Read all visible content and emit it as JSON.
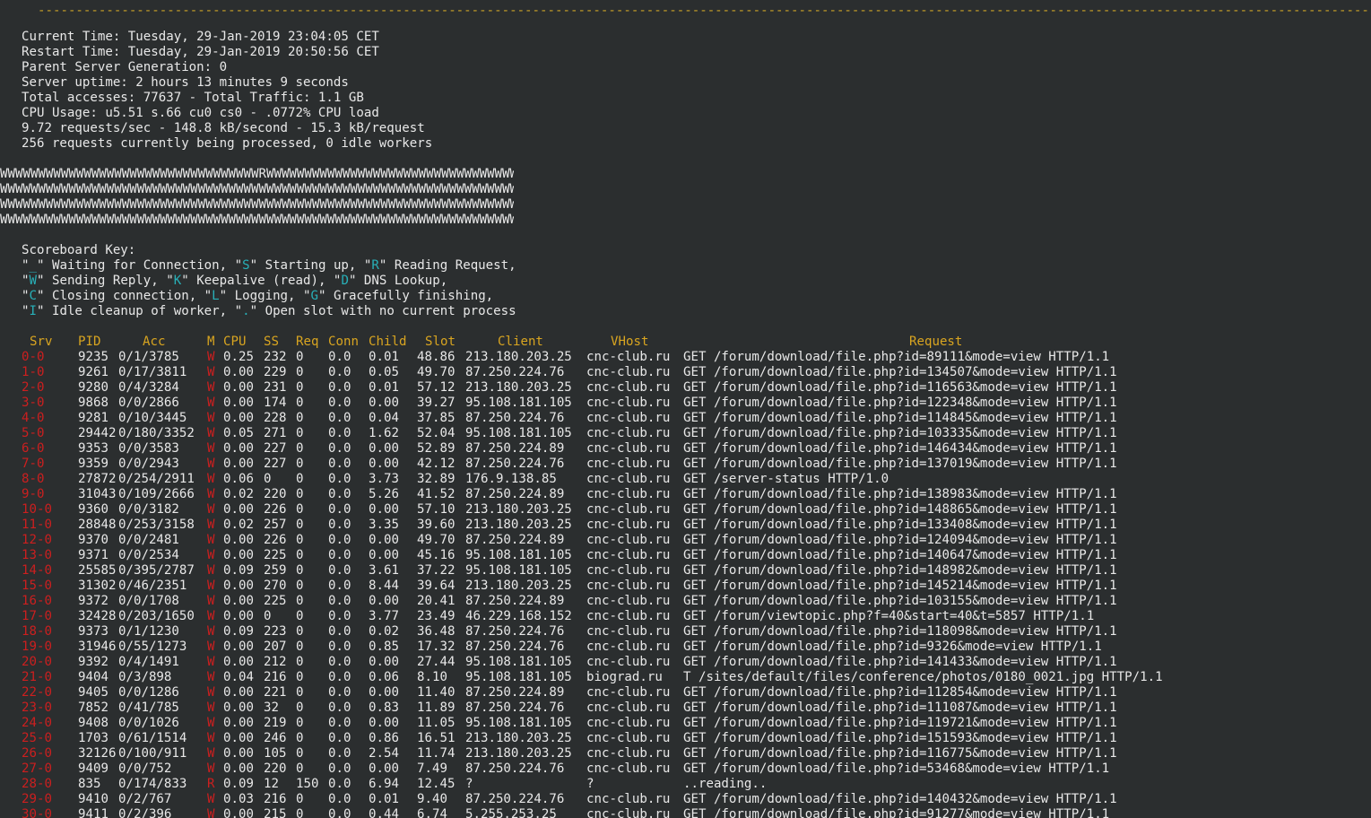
{
  "dashes": "----------------------------------------------------------------------------------------------------------------------------------------------------------------------------------------------------------------------------",
  "info": [
    "Current Time: Tuesday, 29-Jan-2019 23:04:05 CET",
    "Restart Time: Tuesday, 29-Jan-2019 20:50:56 CET",
    "Parent Server Generation: 0",
    "Server uptime: 2 hours 13 minutes 9 seconds",
    "Total accesses: 77637 - Total Traffic: 1.1 GB",
    "CPU Usage: u5.51 s.66 cu0 cs0 - .0772% CPU load",
    "9.72 requests/sec - 148.8 kB/second - 15.3 kB/request",
    "256 requests currently being processed, 0 idle workers"
  ],
  "scoreboard": [
    "WWWWWWWWWWWWWWWWWWWWWWWWWWWWWWWWWWRWWWWWWWWWWWWWWWWWWWWWWWWWWWWWWWWWWWW",
    "WWWWWWWWWWWWWWWWWWWWWWWWWWWWWWWWWWWWWWWWWWWWWWWWWWWWWWWWWWWWWWWWWWWWWWWW",
    "WWWWWWWWWWWWWWWWWWWWWWWWWWWWWWWWWWWWWWWWWWWWWWWWWWWWWWWWWWWWWWWWWWWWWWWW",
    "WWWWWWWWWWWWWWWWWWWWWWWWWWWWWWWWWWWWWWWWWWWWWWWWWWWWWWWWWWWWWWWWWWWWWWWW"
  ],
  "key": {
    "title": "Scoreboard Key:",
    "lines": [
      [
        [
          "\"",
          "q"
        ],
        [
          "_",
          "kc"
        ],
        [
          "\" Waiting for Connection, \"",
          "q"
        ],
        [
          "S",
          "kc"
        ],
        [
          "\" Starting up, \"",
          "q"
        ],
        [
          "R",
          "kc"
        ],
        [
          "\" Reading Request,",
          "q"
        ]
      ],
      [
        [
          "\"",
          "q"
        ],
        [
          "W",
          "kc"
        ],
        [
          "\" Sending Reply, \"",
          "q"
        ],
        [
          "K",
          "kc"
        ],
        [
          "\" Keepalive (read), \"",
          "q"
        ],
        [
          "D",
          "kc"
        ],
        [
          "\" DNS Lookup,",
          "q"
        ]
      ],
      [
        [
          "\"",
          "q"
        ],
        [
          "C",
          "kc"
        ],
        [
          "\" Closing connection, \"",
          "q"
        ],
        [
          "L",
          "kc"
        ],
        [
          "\" Logging, \"",
          "q"
        ],
        [
          "G",
          "kc"
        ],
        [
          "\" Gracefully finishing,",
          "q"
        ]
      ],
      [
        [
          "\"",
          "q"
        ],
        [
          "I",
          "kc"
        ],
        [
          "\" Idle cleanup of worker, \"",
          "q"
        ],
        [
          ".",
          "kc"
        ],
        [
          "\" Open slot with no current process",
          "q"
        ]
      ]
    ]
  },
  "table": {
    "headers": [
      "Srv",
      "PID",
      "Acc",
      "M",
      "CPU",
      "SS",
      "Req",
      "Conn",
      "Child",
      "Slot",
      "Client",
      "VHost",
      "Request"
    ],
    "rows": [
      [
        "0-0",
        "9235",
        "0/1/3785",
        "W",
        "0.25",
        "232",
        "0",
        "0.0",
        "0.01",
        "48.86",
        "213.180.203.25",
        "cnc-club.ru",
        "GET /forum/download/file.php?id=89111&mode=view HTTP/1.1"
      ],
      [
        "1-0",
        "9261",
        "0/17/3811",
        "W",
        "0.00",
        "229",
        "0",
        "0.0",
        "0.05",
        "49.70",
        "87.250.224.76",
        "cnc-club.ru",
        "GET /forum/download/file.php?id=134507&mode=view HTTP/1.1"
      ],
      [
        "2-0",
        "9280",
        "0/4/3284",
        "W",
        "0.00",
        "231",
        "0",
        "0.0",
        "0.01",
        "57.12",
        "213.180.203.25",
        "cnc-club.ru",
        "GET /forum/download/file.php?id=116563&mode=view HTTP/1.1"
      ],
      [
        "3-0",
        "9868",
        "0/0/2866",
        "W",
        "0.00",
        "174",
        "0",
        "0.0",
        "0.00",
        "39.27",
        "95.108.181.105",
        "cnc-club.ru",
        "GET /forum/download/file.php?id=122348&mode=view HTTP/1.1"
      ],
      [
        "4-0",
        "9281",
        "0/10/3445",
        "W",
        "0.00",
        "228",
        "0",
        "0.0",
        "0.04",
        "37.85",
        "87.250.224.76",
        "cnc-club.ru",
        "GET /forum/download/file.php?id=114845&mode=view HTTP/1.1"
      ],
      [
        "5-0",
        "29442",
        "0/180/3352",
        "W",
        "0.05",
        "271",
        "0",
        "0.0",
        "1.62",
        "52.04",
        "95.108.181.105",
        "cnc-club.ru",
        "GET /forum/download/file.php?id=103335&mode=view HTTP/1.1"
      ],
      [
        "6-0",
        "9353",
        "0/0/3583",
        "W",
        "0.00",
        "227",
        "0",
        "0.0",
        "0.00",
        "52.89",
        "87.250.224.89",
        "cnc-club.ru",
        "GET /forum/download/file.php?id=146434&mode=view HTTP/1.1"
      ],
      [
        "7-0",
        "9359",
        "0/0/2943",
        "W",
        "0.00",
        "227",
        "0",
        "0.0",
        "0.00",
        "42.12",
        "87.250.224.76",
        "cnc-club.ru",
        "GET /forum/download/file.php?id=137019&mode=view HTTP/1.1"
      ],
      [
        "8-0",
        "27872",
        "0/254/2911",
        "W",
        "0.06",
        "0",
        "0",
        "0.0",
        "3.73",
        "32.89",
        "176.9.138.85",
        "cnc-club.ru",
        "GET /server-status HTTP/1.0"
      ],
      [
        "9-0",
        "31043",
        "0/109/2666",
        "W",
        "0.02",
        "220",
        "0",
        "0.0",
        "5.26",
        "41.52",
        "87.250.224.89",
        "cnc-club.ru",
        "GET /forum/download/file.php?id=138983&mode=view HTTP/1.1"
      ],
      [
        "10-0",
        "9360",
        "0/0/3182",
        "W",
        "0.00",
        "226",
        "0",
        "0.0",
        "0.00",
        "57.10",
        "213.180.203.25",
        "cnc-club.ru",
        "GET /forum/download/file.php?id=148865&mode=view HTTP/1.1"
      ],
      [
        "11-0",
        "28848",
        "0/253/3158",
        "W",
        "0.02",
        "257",
        "0",
        "0.0",
        "3.35",
        "39.60",
        "213.180.203.25",
        "cnc-club.ru",
        "GET /forum/download/file.php?id=133408&mode=view HTTP/1.1"
      ],
      [
        "12-0",
        "9370",
        "0/0/2481",
        "W",
        "0.00",
        "226",
        "0",
        "0.0",
        "0.00",
        "49.70",
        "87.250.224.89",
        "cnc-club.ru",
        "GET /forum/download/file.php?id=124094&mode=view HTTP/1.1"
      ],
      [
        "13-0",
        "9371",
        "0/0/2534",
        "W",
        "0.00",
        "225",
        "0",
        "0.0",
        "0.00",
        "45.16",
        "95.108.181.105",
        "cnc-club.ru",
        "GET /forum/download/file.php?id=140647&mode=view HTTP/1.1"
      ],
      [
        "14-0",
        "25585",
        "0/395/2787",
        "W",
        "0.09",
        "259",
        "0",
        "0.0",
        "3.61",
        "37.22",
        "95.108.181.105",
        "cnc-club.ru",
        "GET /forum/download/file.php?id=148982&mode=view HTTP/1.1"
      ],
      [
        "15-0",
        "31302",
        "0/46/2351",
        "W",
        "0.00",
        "270",
        "0",
        "0.0",
        "8.44",
        "39.64",
        "213.180.203.25",
        "cnc-club.ru",
        "GET /forum/download/file.php?id=145214&mode=view HTTP/1.1"
      ],
      [
        "16-0",
        "9372",
        "0/0/1708",
        "W",
        "0.00",
        "225",
        "0",
        "0.0",
        "0.00",
        "20.41",
        "87.250.224.89",
        "cnc-club.ru",
        "GET /forum/download/file.php?id=103155&mode=view HTTP/1.1"
      ],
      [
        "17-0",
        "32428",
        "0/203/1650",
        "W",
        "0.00",
        "0",
        "0",
        "0.0",
        "3.77",
        "23.49",
        "46.229.168.152",
        "cnc-club.ru",
        "GET /forum/viewtopic.php?f=40&start=40&t=5857 HTTP/1.1"
      ],
      [
        "18-0",
        "9373",
        "0/1/1230",
        "W",
        "0.09",
        "223",
        "0",
        "0.0",
        "0.02",
        "36.48",
        "87.250.224.76",
        "cnc-club.ru",
        "GET /forum/download/file.php?id=118098&mode=view HTTP/1.1"
      ],
      [
        "19-0",
        "31946",
        "0/55/1273",
        "W",
        "0.00",
        "207",
        "0",
        "0.0",
        "0.85",
        "17.32",
        "87.250.224.76",
        "cnc-club.ru",
        "GET /forum/download/file.php?id=9326&mode=view HTTP/1.1"
      ],
      [
        "20-0",
        "9392",
        "0/4/1491",
        "W",
        "0.00",
        "212",
        "0",
        "0.0",
        "0.00",
        "27.44",
        "95.108.181.105",
        "cnc-club.ru",
        "GET /forum/download/file.php?id=141433&mode=view HTTP/1.1"
      ],
      [
        "21-0",
        "9404",
        "0/3/898",
        "W",
        "0.04",
        "216",
        "0",
        "0.0",
        "0.06",
        "8.10",
        "95.108.181.105",
        "biograd.ru",
        "T /sites/default/files/conference/photos/0180_0021.jpg HTTP/1.1"
      ],
      [
        "22-0",
        "9405",
        "0/0/1286",
        "W",
        "0.00",
        "221",
        "0",
        "0.0",
        "0.00",
        "11.40",
        "87.250.224.89",
        "cnc-club.ru",
        "GET /forum/download/file.php?id=112854&mode=view HTTP/1.1"
      ],
      [
        "23-0",
        "7852",
        "0/41/785",
        "W",
        "0.00",
        "32",
        "0",
        "0.0",
        "0.83",
        "11.89",
        "87.250.224.76",
        "cnc-club.ru",
        "GET /forum/download/file.php?id=111087&mode=view HTTP/1.1"
      ],
      [
        "24-0",
        "9408",
        "0/0/1026",
        "W",
        "0.00",
        "219",
        "0",
        "0.0",
        "0.00",
        "11.05",
        "95.108.181.105",
        "cnc-club.ru",
        "GET /forum/download/file.php?id=119721&mode=view HTTP/1.1"
      ],
      [
        "25-0",
        "1703",
        "0/61/1514",
        "W",
        "0.00",
        "246",
        "0",
        "0.0",
        "0.86",
        "16.51",
        "213.180.203.25",
        "cnc-club.ru",
        "GET /forum/download/file.php?id=151593&mode=view HTTP/1.1"
      ],
      [
        "26-0",
        "32126",
        "0/100/911",
        "W",
        "0.00",
        "105",
        "0",
        "0.0",
        "2.54",
        "11.74",
        "213.180.203.25",
        "cnc-club.ru",
        "GET /forum/download/file.php?id=116775&mode=view HTTP/1.1"
      ],
      [
        "27-0",
        "9409",
        "0/0/752",
        "W",
        "0.00",
        "220",
        "0",
        "0.0",
        "0.00",
        "7.49",
        "87.250.224.76",
        "cnc-club.ru",
        "GET /forum/download/file.php?id=53468&mode=view HTTP/1.1"
      ],
      [
        "28-0",
        "835",
        "0/174/833",
        "R",
        "0.09",
        "12",
        "150",
        "0.0",
        "6.94",
        "12.45",
        "?",
        "?",
        "..reading.."
      ],
      [
        "29-0",
        "9410",
        "0/2/767",
        "W",
        "0.03",
        "216",
        "0",
        "0.0",
        "0.01",
        "9.40",
        "87.250.224.76",
        "cnc-club.ru",
        "GET /forum/download/file.php?id=140432&mode=view HTTP/1.1"
      ],
      [
        "30-0",
        "9411",
        "0/2/396",
        "W",
        "0.00",
        "215",
        "0",
        "0.0",
        "0.44",
        "6.74",
        "5.255.253.25",
        "cnc-club.ru",
        "GET /forum/download/file.php?id=91277&mode=view HTTP/1.1"
      ]
    ]
  }
}
